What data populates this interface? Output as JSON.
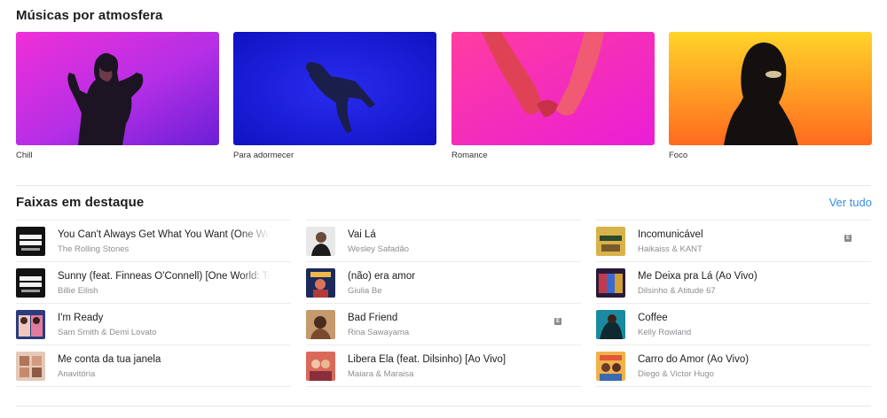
{
  "moods": {
    "title": "Músicas por atmosfera",
    "cards": [
      {
        "label": "Chill"
      },
      {
        "label": "Para adormecer"
      },
      {
        "label": "Romance"
      },
      {
        "label": "Foco"
      }
    ]
  },
  "featured": {
    "title": "Faixas em destaque",
    "see_all": "Ver tudo",
    "explicit_badge": "E",
    "columns": [
      [
        {
          "title": "You Can't Always Get What You Want (One World",
          "artist": "The Rolling Stones"
        },
        {
          "title": "Sunny (feat. Finneas O'Connell) [One World: Together",
          "artist": "Billie Eilish"
        },
        {
          "title": "I'm Ready",
          "artist": "Sam Smith & Demi Lovato"
        },
        {
          "title": "Me conta da tua janela",
          "artist": "Anavitória"
        }
      ],
      [
        {
          "title": "Vai Lá",
          "artist": "Wesley Safadão"
        },
        {
          "title": "(não) era amor",
          "artist": "Giulia Be"
        },
        {
          "title": "Bad Friend",
          "artist": "Rina Sawayama",
          "explicit": true
        },
        {
          "title": "Libera Ela (feat. Dilsinho) [Ao Vivo]",
          "artist": "Maiara & Maraisa"
        }
      ],
      [
        {
          "title": "Incomunicável",
          "artist": "Haikaiss & KANT",
          "explicit": true
        },
        {
          "title": "Me Deixa pra Lá (Ao Vivo)",
          "artist": "Dilsinho & Atitude 67"
        },
        {
          "title": "Coffee",
          "artist": "Kelly Rowland"
        },
        {
          "title": "Carro do Amor (Ao Vivo)",
          "artist": "Diego & Victor Hugo"
        }
      ]
    ]
  }
}
